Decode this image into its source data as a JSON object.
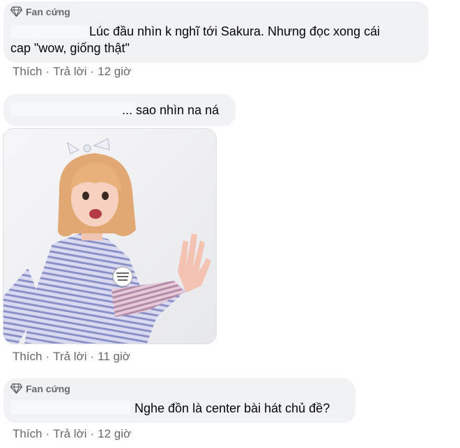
{
  "comments": [
    {
      "badge": "Fan cứng",
      "badge_icon": "diamond-icon",
      "line1": "Lúc đầu nhìn k nghĩ tới Sakura. Nhưng đọc xong cái",
      "line2": "cap \"wow, giống thật\"",
      "like": "Thích",
      "reply": "Trả lời",
      "time": "12 giờ"
    },
    {
      "text": "... sao nhìn na ná",
      "photo_icon": "photo-of-girl-surprised",
      "like": "Thích",
      "reply": "Trả lời",
      "time": "11 giờ"
    },
    {
      "badge": "Fan cứng",
      "badge_icon": "diamond-icon",
      "text": "Nghe đồn là center bài hát chủ đề?",
      "like": "Thích",
      "reply": "Trả lời",
      "time": "12 giờ"
    }
  ],
  "separator": "·",
  "colors": {
    "bubble": "#f0f2f5",
    "meta_text": "#65676b",
    "text": "#050505"
  }
}
